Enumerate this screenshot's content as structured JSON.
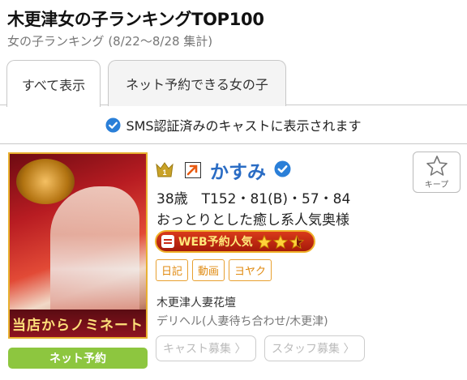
{
  "header": {
    "title": "木更津女の子ランキングTOP100",
    "subtitle": "女の子ランキング (8/22〜8/28 集計)"
  },
  "tabs": [
    {
      "label": "すべて表示",
      "active": true
    },
    {
      "label": "ネット予約できる女の子",
      "active": false
    }
  ],
  "sms_notice": "SMS認証済みのキャストに表示されます",
  "cast": {
    "rank": "1",
    "name": "かすみ",
    "stats": "38歳　T152・81(B)・57・84",
    "catchphrase": "おっとりとした癒し系人気奥様",
    "web_badge_label": "WEB予約人気",
    "web_badge_stars": 2.5,
    "tags": [
      "日記",
      "動画",
      "ヨヤク"
    ],
    "shop_name": "木更津人妻花壇",
    "shop_type": "デリヘル(人妻待ち合わせ/木更津)",
    "photo_banner": "当店からノミネート",
    "keep_label": "キープ",
    "net_reserve_label": "ネット予約",
    "recruit_buttons": [
      "キャスト募集 〉",
      "スタッフ募集 〉"
    ]
  },
  "colors": {
    "accent_blue": "#2a6cc4",
    "net_green": "#8dc63f",
    "tag_orange": "#e08a10",
    "badge_red": "#c82a14"
  }
}
